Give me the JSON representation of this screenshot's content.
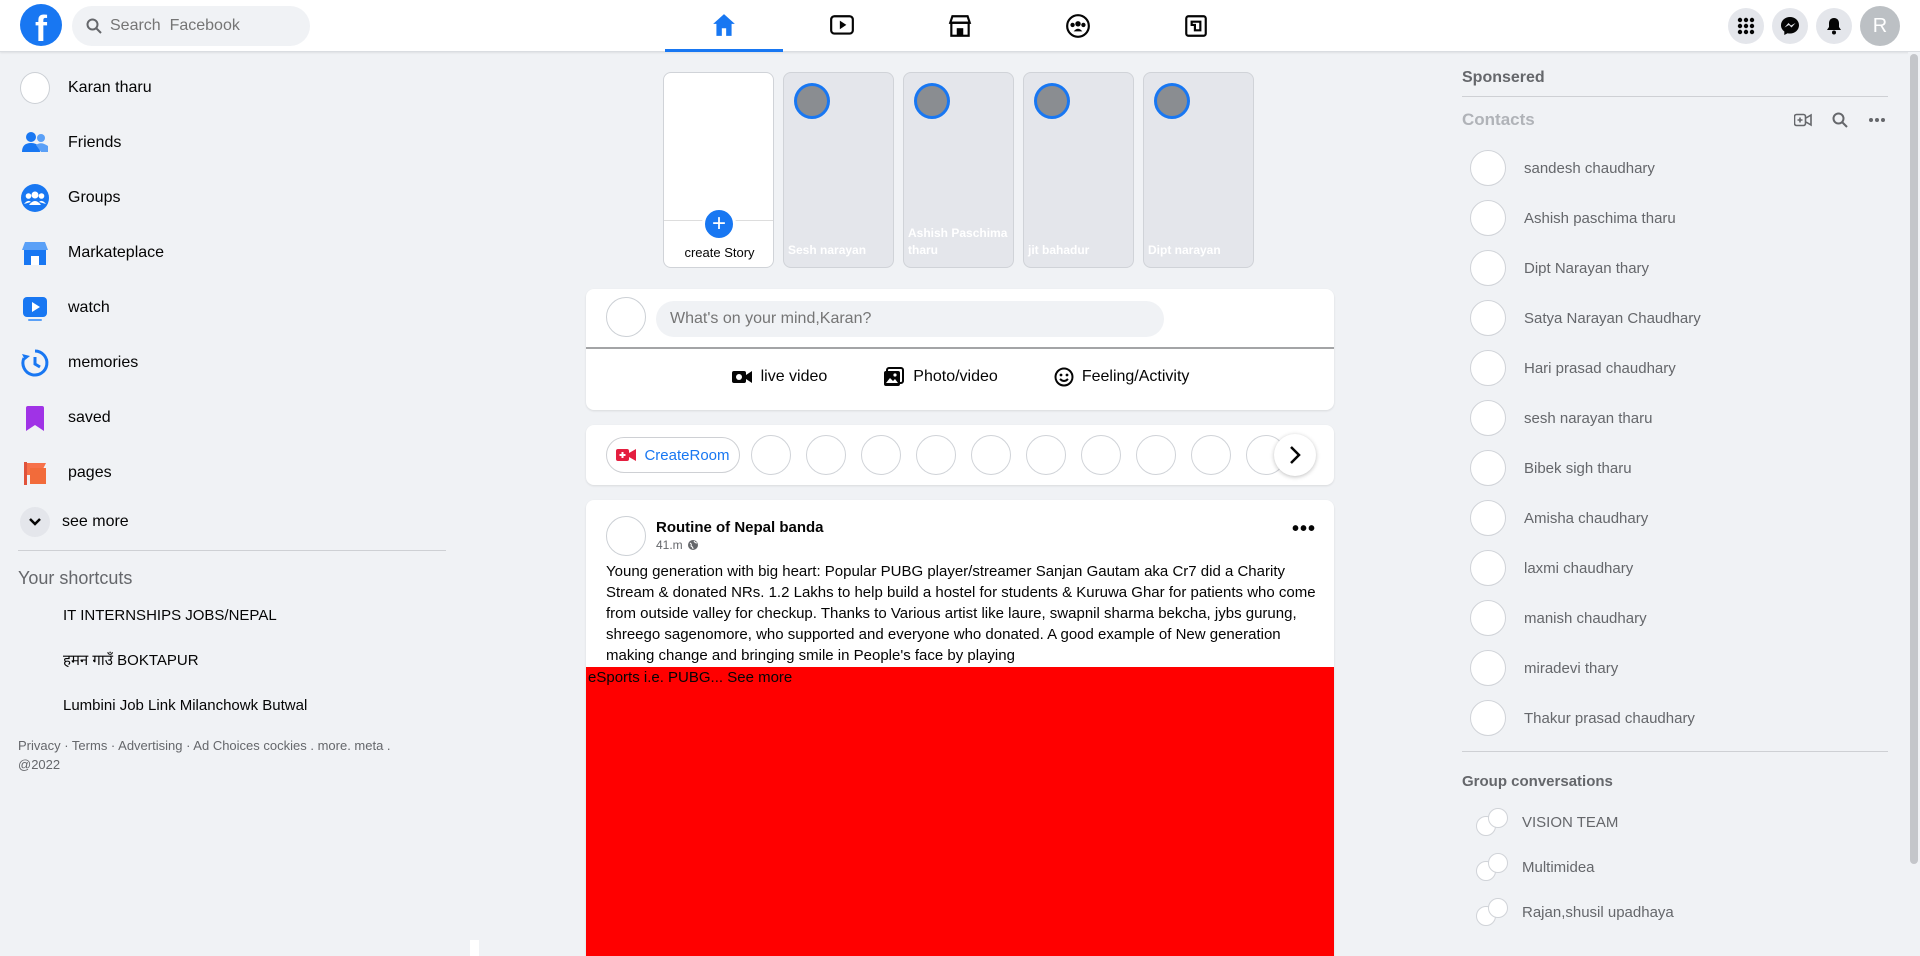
{
  "topnav": {
    "logo": "f",
    "search_placeholder": "Search  Facebook",
    "tabs": [
      {
        "name": "home",
        "icon": "home-icon",
        "active": true
      },
      {
        "name": "watch",
        "icon": "video-icon",
        "active": false
      },
      {
        "name": "marketplace",
        "icon": "store-icon",
        "active": false
      },
      {
        "name": "groups",
        "icon": "groups-icon",
        "active": false
      },
      {
        "name": "gaming",
        "icon": "gaming-icon",
        "active": false
      }
    ],
    "right": {
      "menu_icon": "grid-icon",
      "messenger_icon": "messenger-icon",
      "notifications_icon": "bell-icon",
      "avatar_letter": "R"
    }
  },
  "left_sidebar": {
    "items": [
      {
        "label": "Karan tharu",
        "icon": "profile-picture"
      },
      {
        "label": "Friends",
        "icon": "friends-icon"
      },
      {
        "label": "Groups",
        "icon": "groups-icon"
      },
      {
        "label": "Markateplace",
        "icon": "marketplace-icon"
      },
      {
        "label": "watch",
        "icon": "watch-icon"
      },
      {
        "label": "memories",
        "icon": "memories-icon"
      },
      {
        "label": "saved",
        "icon": "saved-icon"
      },
      {
        "label": "pages",
        "icon": "pages-icon"
      }
    ],
    "see_more": "see more",
    "shortcuts_title": "Your shortcuts",
    "shortcuts": [
      "IT INTERNSHIPS JOBS/NEPAL",
      "हमन गाउँ BOKTAPUR",
      "Lumbini Job Link Milanchowk Butwal"
    ],
    "footer": "Privacy · Terms · Advertising · Ad Choices cockies . more. meta . @2022"
  },
  "stories": {
    "create_label": "create Story",
    "items": [
      {
        "name": "Sesh narayan"
      },
      {
        "name": "Ashish Paschima tharu"
      },
      {
        "name": "jit bahadur"
      },
      {
        "name": "Dipt narayan"
      }
    ]
  },
  "composer": {
    "placeholder": "What's on your mind,Karan?",
    "actions": [
      {
        "label": "live video",
        "icon": "live-video-icon",
        "color": "#050505"
      },
      {
        "label": "Photo/video",
        "icon": "photo-icon",
        "color": "#050505"
      },
      {
        "label": "Feeling/Activity",
        "icon": "smile-icon",
        "color": "#050505"
      }
    ]
  },
  "rooms": {
    "create_label": "CreateRoom",
    "avatar_count": 10
  },
  "post": {
    "author": "Routine of Nepal banda",
    "time": "41.m",
    "text": "Young generation with big heart: Popular PUBG player/streamer Sanjan Gautam aka Cr7 did a Charity Stream & donated NRs. 1.2 Lakhs to help build a hostel for students & Kuruwa Ghar for patients who come from outside valley for checkup. Thanks to Various artist like laure, swapnil sharma bekcha, jybs gurung, shreego sagenomore, who supported and everyone who donated. A good example of New generation making change and bringing smile in People's face by playing",
    "media_alt": "eSports i.e. PUBG...",
    "see_more": "See more",
    "media_color": "#ff0000"
  },
  "right_sidebar": {
    "sponsored": "Sponsered",
    "contacts_title": "Contacts",
    "contacts": [
      "sandesh chaudhary",
      "Ashish paschima tharu",
      "Dipt Narayan thary",
      "Satya Narayan Chaudhary",
      "Hari prasad chaudhary",
      "sesh narayan tharu",
      "Bibek sigh tharu",
      "Amisha chaudhary",
      "laxmi chaudhary",
      "manish chaudhary",
      "miradevi thary",
      "Thakur prasad chaudhary"
    ],
    "group_title": "Group conversations",
    "groups": [
      "VISION TEAM",
      "Multimidea",
      "Rajan,shusil upadhaya"
    ]
  },
  "colors": {
    "accent": "#1877f2",
    "background": "#f0f2f5"
  }
}
